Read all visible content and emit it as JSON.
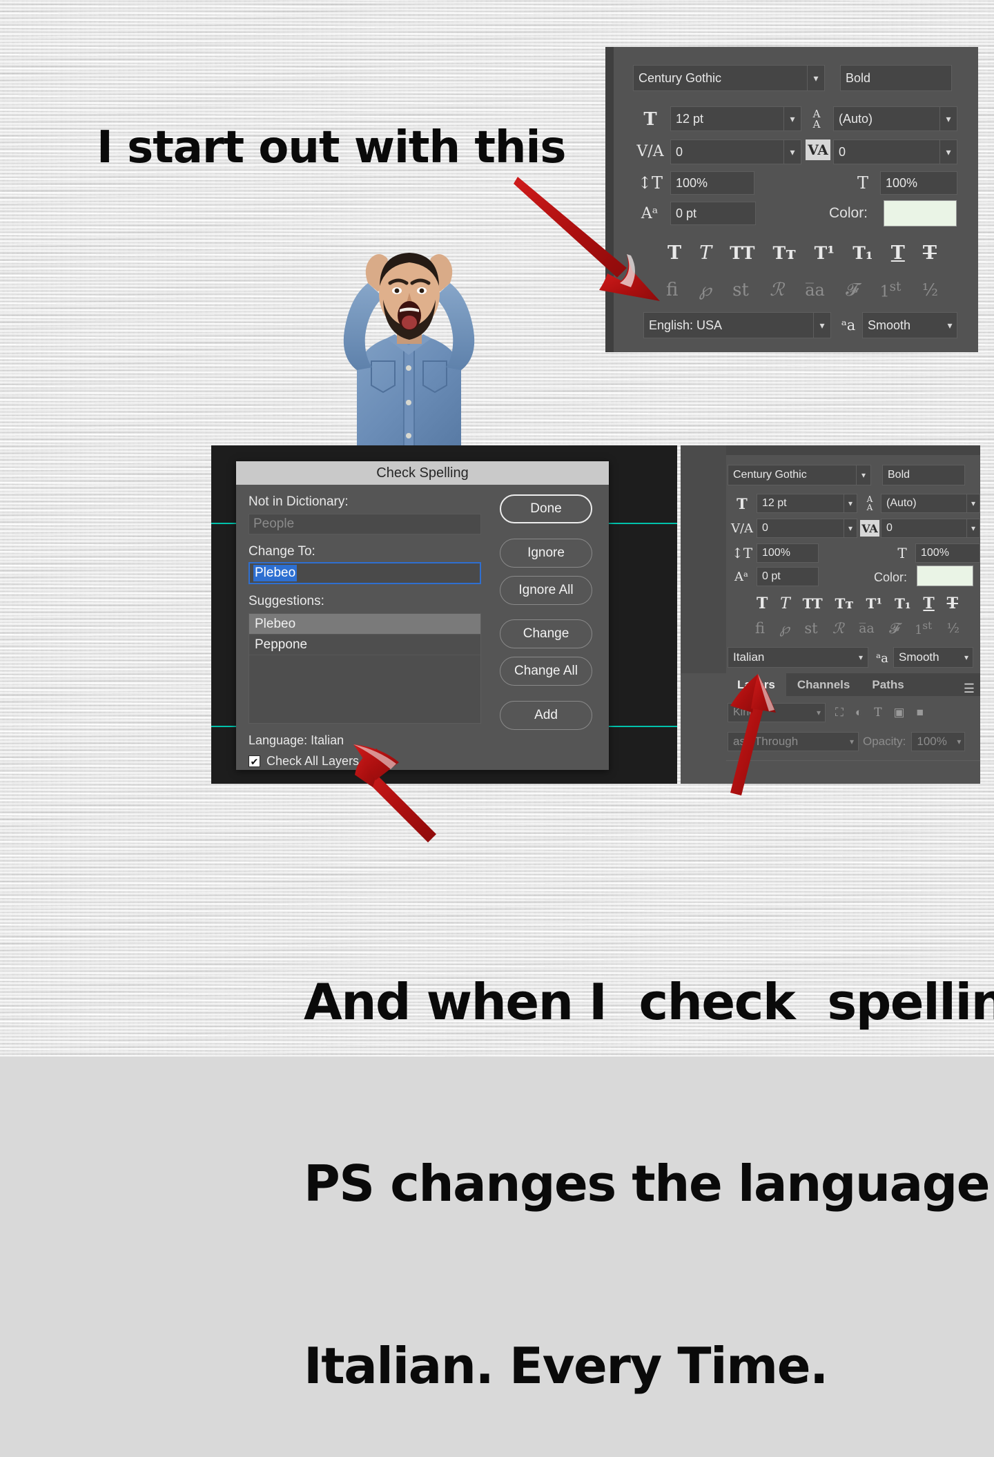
{
  "meme": {
    "headline": "I start out with this",
    "caption_lines": [
      "And when I  check  spelling,",
      "PS changes the language to",
      "Italian. Every Time."
    ]
  },
  "colors": {
    "arrow_red": "#b81414",
    "guide_teal": "#00c2ab",
    "panel_grey": "#535353",
    "field_grey": "#454545",
    "dialog_grey": "#555555",
    "titlebar_grey": "#c9c9c9",
    "swatch": "#eaf4e6",
    "selection_blue": "#2d6fd1"
  },
  "character_panel_top": {
    "font_family": "Century Gothic",
    "font_style": "Bold",
    "size_icon": "font-size-icon",
    "size": "12 pt",
    "leading_icon": "leading-icon",
    "leading": "(Auto)",
    "kerning_icon": "kerning-icon",
    "kerning": "0",
    "tracking_icon": "tracking-icon",
    "tracking": "0",
    "vscale_icon": "vertical-scale-icon",
    "vertical_scale": "100%",
    "hscale_icon": "horizontal-scale-icon",
    "horizontal_scale": "100%",
    "baseline_icon": "baseline-shift-icon",
    "baseline_shift": "0 pt",
    "color_label": "Color:",
    "color_value": "#eaf4e6",
    "style_buttons": [
      {
        "glyph": "T",
        "name": "faux-bold-icon"
      },
      {
        "glyph": "T",
        "name": "faux-italic-icon"
      },
      {
        "glyph": "TT",
        "name": "all-caps-icon"
      },
      {
        "glyph": "Tт",
        "name": "small-caps-icon"
      },
      {
        "glyph": "T¹",
        "name": "superscript-icon"
      },
      {
        "glyph": "T₁",
        "name": "subscript-icon"
      },
      {
        "glyph": "T",
        "name": "underline-icon"
      },
      {
        "glyph": "Ŧ",
        "name": "strikethrough-icon"
      }
    ],
    "opentype_buttons": [
      {
        "glyph": "fi",
        "name": "standard-ligatures-icon"
      },
      {
        "glyph": "℘",
        "name": "contextual-alternates-icon"
      },
      {
        "glyph": "st",
        "name": "discretionary-ligatures-icon"
      },
      {
        "glyph": "ℛ",
        "name": "swash-icon"
      },
      {
        "glyph": "a̅a",
        "name": "oldstyle-icon"
      },
      {
        "glyph": "ℙ",
        "name": "titling-alternates-icon"
      },
      {
        "glyph": "1st",
        "name": "ordinals-icon"
      },
      {
        "glyph": "½",
        "name": "fractions-icon"
      }
    ],
    "language": "English: USA",
    "antialias_icon": "anti-alias-icon",
    "antialias": "Smooth"
  },
  "character_panel_bottom": {
    "font_family": "Century Gothic",
    "font_style": "Bold",
    "size": "12 pt",
    "leading": "(Auto)",
    "kerning": "0",
    "tracking": "0",
    "vertical_scale": "100%",
    "horizontal_scale": "100%",
    "baseline_shift": "0 pt",
    "color_label": "Color:",
    "color_value": "#eaf4e6",
    "language": "Italian",
    "antialias": "Smooth"
  },
  "layers_panel": {
    "tabs": [
      {
        "label": "Layers",
        "active": true
      },
      {
        "label": "Channels",
        "active": false
      },
      {
        "label": "Paths",
        "active": false
      }
    ],
    "menu_icon": "panel-menu-icon",
    "filter_label": "Kind",
    "filter_icons": [
      "filter-image-icon",
      "filter-adjustment-icon",
      "filter-type-icon",
      "filter-shape-icon",
      "filter-smartobject-icon"
    ],
    "blend_mode": "ass Through",
    "opacity_label": "Opacity:",
    "opacity_value": "100%"
  },
  "check_spelling": {
    "title": "Check Spelling",
    "not_in_dictionary_label": "Not in Dictionary:",
    "not_in_dictionary_value": "People",
    "change_to_label": "Change To:",
    "change_to_value": "Plebeo",
    "suggestions_label": "Suggestions:",
    "suggestions": [
      {
        "text": "Plebeo",
        "selected": true
      },
      {
        "text": "Peppone",
        "selected": false
      }
    ],
    "language_status": "Language: Italian",
    "check_all_layers_label": "Check All Layers",
    "check_all_layers_checked": true,
    "checkmark": "✔",
    "buttons": [
      {
        "label": "Done",
        "default": true
      },
      {
        "label": "Ignore",
        "default": false
      },
      {
        "label": "Ignore All",
        "default": false
      },
      {
        "label": "Change",
        "default": false
      },
      {
        "label": "Change All",
        "default": false
      },
      {
        "label": "Add",
        "default": false
      }
    ]
  },
  "annotations": {
    "arrow_to_language_top": "arrow-pointing-to-english-usa",
    "arrow_to_language_dialog": "arrow-pointing-to-language-italian",
    "arrow_to_language_bottom": "arrow-pointing-to-italian-dropdown"
  },
  "photo": {
    "alt_name": "frustrated-man-pulling-hair"
  }
}
